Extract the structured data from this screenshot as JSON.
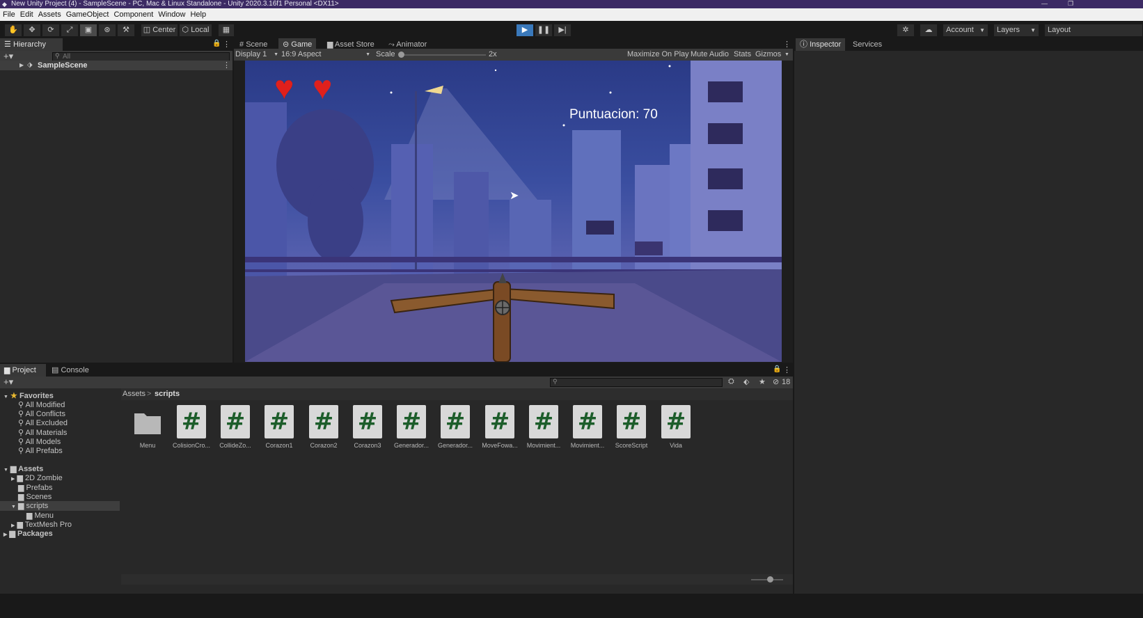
{
  "window": {
    "title": "New Unity Project (4) - SampleScene - PC, Mac & Linux Standalone - Unity 2020.3.16f1 Personal <DX11>",
    "min_glyph": "—",
    "max_glyph": "❐"
  },
  "menu": [
    "File",
    "Edit",
    "Assets",
    "GameObject",
    "Component",
    "Window",
    "Help"
  ],
  "toolbar": {
    "tools": [
      "✋",
      "✥",
      "⟳",
      "⤢",
      "▣",
      "⊛",
      "⚒"
    ],
    "center_label": "Center",
    "local_label": "Local",
    "account_label": "Account",
    "layers_label": "Layers",
    "layout_label": "Layout"
  },
  "hierarchy": {
    "tab_label": "Hierarchy",
    "search_placeholder": "All",
    "scene_name": "SampleScene"
  },
  "center_tabs": [
    "Scene",
    "Game",
    "Asset Store",
    "Animator"
  ],
  "game_toolbar": {
    "display": "Display 1",
    "aspect": "16:9 Aspect",
    "scale_label": "Scale",
    "scale_value": "2x",
    "maximize": "Maximize On Play",
    "mute": "Mute Audio",
    "stats": "Stats",
    "gizmos": "Gizmos"
  },
  "game_view": {
    "score_text": "Puntuacion: 70",
    "hearts": 2
  },
  "right_tabs": [
    "Inspector",
    "Services"
  ],
  "bottom_tabs": [
    "Project",
    "Console"
  ],
  "project": {
    "hidden_count": "18",
    "breadcrumb_root": "Assets",
    "breadcrumb_sep": ">",
    "breadcrumb_current": "scripts",
    "favorites_label": "Favorites",
    "favorites": [
      "All Modified",
      "All Conflicts",
      "All Excluded",
      "All Materials",
      "All Models",
      "All Prefabs"
    ],
    "assets_label": "Assets",
    "asset_folders": [
      "2D Zombie",
      "Prefabs",
      "Scenes",
      "scripts",
      "Menu",
      "TextMesh Pro"
    ],
    "packages_label": "Packages",
    "files": [
      "Menu",
      "ColisionCro...",
      "CollideZo...",
      "Corazon1",
      "Corazon2",
      "Corazon3",
      "Generador...",
      "Generador...",
      "MoveFowa...",
      "Movimient...",
      "Movimient...",
      "ScoreScript",
      "Vida"
    ]
  },
  "colors": {
    "title_bar": "#3c2a64",
    "play_button": "#3a79bb",
    "script_icon_hash": "#1c5d2a",
    "heart": "#e0201c"
  }
}
